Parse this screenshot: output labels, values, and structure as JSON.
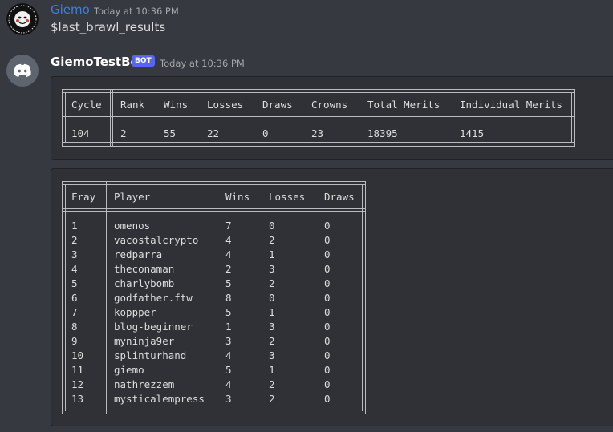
{
  "message1": {
    "author": "Giemo",
    "author_color": "#3f7ed6",
    "timestamp": "Today at 10:36 PM",
    "text": "$last_brawl_results"
  },
  "message2": {
    "author": "GiemoTestBot",
    "bot_tag": "BOT",
    "timestamp": "Today at 10:36 PM"
  },
  "table1": {
    "headers": [
      "Cycle",
      "Rank",
      "Wins",
      "Losses",
      "Draws",
      "Crowns",
      "Total Merits",
      "Individual Merits"
    ],
    "rows": [
      [
        "104",
        "2",
        "55",
        "22",
        "0",
        "23",
        "18395",
        "1415"
      ]
    ]
  },
  "table2": {
    "headers": [
      "Fray",
      "Player",
      "Wins",
      "Losses",
      "Draws"
    ],
    "rows": [
      [
        "1",
        "omenos",
        "7",
        "0",
        "0"
      ],
      [
        "2",
        "vacostalcrypto",
        "4",
        "2",
        "0"
      ],
      [
        "3",
        "redparra",
        "4",
        "1",
        "0"
      ],
      [
        "4",
        "theconaman",
        "2",
        "3",
        "0"
      ],
      [
        "5",
        "charlybomb",
        "5",
        "2",
        "0"
      ],
      [
        "6",
        "godfather.ftw",
        "8",
        "0",
        "0"
      ],
      [
        "7",
        "koppper",
        "5",
        "1",
        "0"
      ],
      [
        "8",
        "blog-beginner",
        "1",
        "3",
        "0"
      ],
      [
        "9",
        "myninja9er",
        "3",
        "2",
        "0"
      ],
      [
        "10",
        "splinturhand",
        "4",
        "3",
        "0"
      ],
      [
        "11",
        "giemo",
        "5",
        "1",
        "0"
      ],
      [
        "12",
        "nathrezzem",
        "4",
        "2",
        "0"
      ],
      [
        "13",
        "mysticalempress",
        "3",
        "2",
        "0"
      ]
    ]
  }
}
